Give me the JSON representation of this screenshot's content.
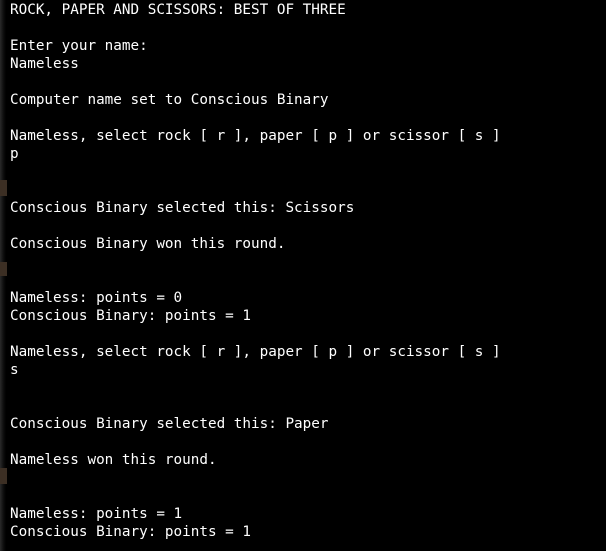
{
  "terminal": {
    "lines": [
      "ROCK, PAPER AND SCISSORS: BEST OF THREE",
      "",
      "Enter your name:",
      "Nameless",
      "",
      "Computer name set to Conscious Binary",
      "",
      "Nameless, select rock [ r ], paper [ p ] or scissor [ s ]",
      "p",
      "",
      "",
      "Conscious Binary selected this: Scissors",
      "",
      "Conscious Binary won this round.",
      "",
      "",
      "Nameless: points = 0",
      "Conscious Binary: points = 1",
      "",
      "Nameless, select rock [ r ], paper [ p ] or scissor [ s ]",
      "s",
      "",
      "",
      "Conscious Binary selected this: Paper",
      "",
      "Nameless won this round.",
      "",
      "",
      "Nameless: points = 1",
      "Conscious Binary: points = 1"
    ]
  },
  "colors": {
    "background": "#000000",
    "text": "#ffffff"
  }
}
